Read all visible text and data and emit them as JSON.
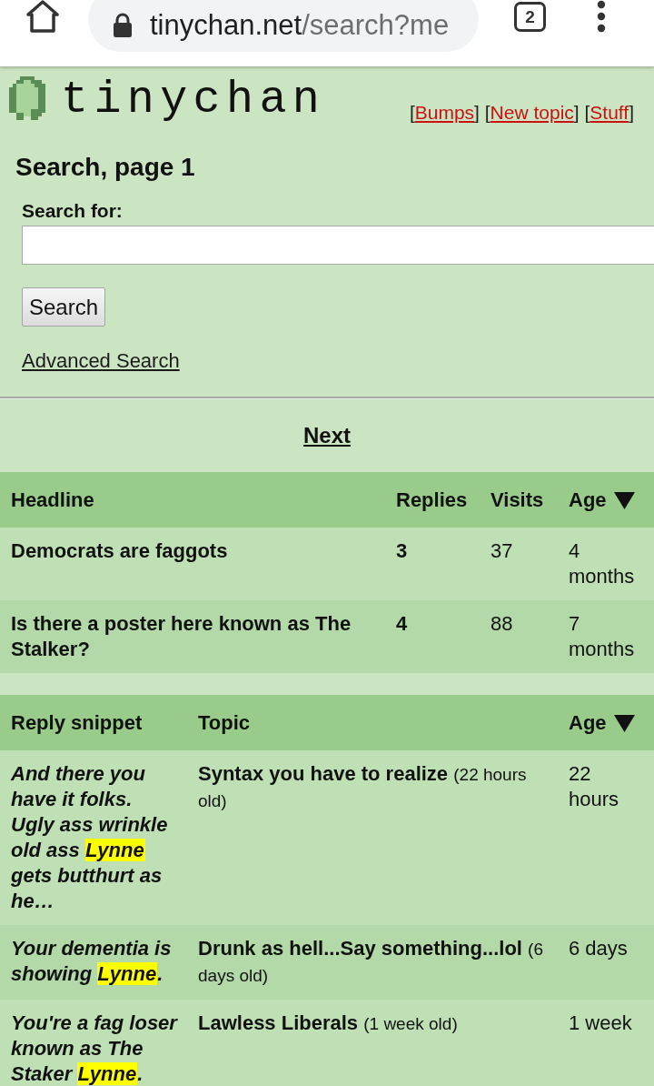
{
  "browser": {
    "url": {
      "host": "tinychan.net",
      "path": "/search?me"
    },
    "tab_count": "2"
  },
  "site": {
    "logo_text": "tinychan",
    "nav_links": [
      {
        "before": "[",
        "label": "Bumps",
        "after": "]"
      },
      {
        "before": "[",
        "label": "New topic",
        "after": "]"
      },
      {
        "before": "[",
        "label": "Stuff",
        "after": "]"
      }
    ]
  },
  "search": {
    "heading": "Search, page 1",
    "label": "Search for:",
    "button": "Search",
    "advanced_link": "Advanced Search"
  },
  "pagination": {
    "next": "Next"
  },
  "topics_table": {
    "columns": [
      {
        "label": "Headline",
        "sorted": false
      },
      {
        "label": "Replies",
        "sorted": false
      },
      {
        "label": "Visits",
        "sorted": false
      },
      {
        "label": "Age",
        "sorted": true
      }
    ],
    "rows": [
      {
        "headline": "Democrats are faggots",
        "replies": "3",
        "visits": "37",
        "age": "4 months"
      },
      {
        "headline": "Is there a poster here known as The Stalker?",
        "replies": "4",
        "visits": "88",
        "age": "7 months"
      }
    ]
  },
  "replies_table": {
    "columns": [
      {
        "label": "Reply snippet",
        "sorted": false
      },
      {
        "label": "Topic",
        "sorted": false
      },
      {
        "label": "Age",
        "sorted": true
      }
    ],
    "rows": [
      {
        "snippet": [
          {
            "text": "And there you have it folks. Ugly ass wrinkle old ass ",
            "highlighted": false
          },
          {
            "text": "Lynne",
            "highlighted": true
          },
          {
            "text": " gets butthurt as he…",
            "highlighted": false
          }
        ],
        "topic": "Syntax you have to realize",
        "topic_age": "(22 hours old)",
        "age": "22 hours"
      },
      {
        "snippet": [
          {
            "text": "Your dementia is showing ",
            "highlighted": false
          },
          {
            "text": "Lynne",
            "highlighted": true
          },
          {
            "text": ".",
            "highlighted": false
          }
        ],
        "topic": "Drunk as hell...Say something...lol",
        "topic_age": "(6 days old)",
        "age": "6 days"
      },
      {
        "snippet": [
          {
            "text": "You're a fag loser known as The Staker ",
            "highlighted": false
          },
          {
            "text": "Lynne",
            "highlighted": true
          },
          {
            "text": ".",
            "highlighted": false
          }
        ],
        "topic": "Lawless Liberals",
        "topic_age": "(1 week old)",
        "age": "1 week"
      }
    ]
  }
}
